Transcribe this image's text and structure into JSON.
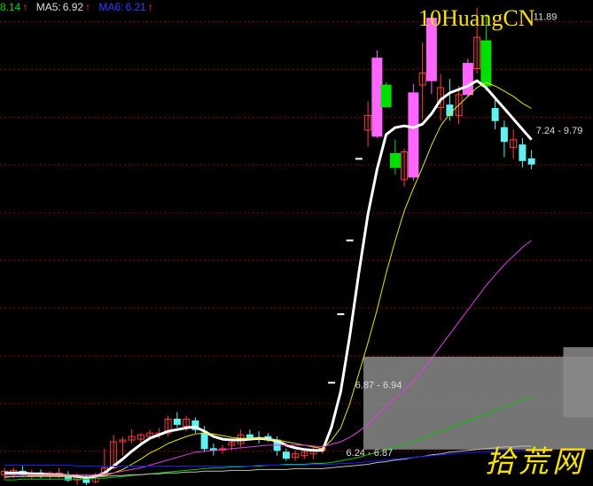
{
  "legend": {
    "ma_first_value": "8.14",
    "ma5_label": "MA5:",
    "ma5_value": "6.92",
    "ma6_label": "MA6:",
    "ma6_value": "6.21",
    "arrow": "↑"
  },
  "brand_text": "10HuangCN",
  "watermark_text": "拾荒网",
  "colors": {
    "background": "#000000",
    "grid": "#8b0000",
    "up_candle": "#ff3b3b",
    "down_candle": "#5ef2f2",
    "highlight_magenta": "#ff66ff",
    "highlight_green": "#00e000",
    "ma_white": "#ffffff",
    "ma_yellow": "#e6e600",
    "ma_magenta": "#e040e0",
    "ma_green": "#00c800",
    "ma_gray": "#bdbdbd",
    "ma_blue": "#1a1aff",
    "zone_fill": "#8a8a8a",
    "legend_green": "#00d000",
    "legend_white": "#dddddd",
    "legend_blue": "#3a3aff",
    "legend_arrow": "#ff3b3b",
    "brand_yellow": "#f5e200"
  },
  "chart_data": {
    "type": "candlestick",
    "price_labels": [
      "11.89",
      "7.24 - 9.79",
      "6.87 - 6.94",
      "6.24 - 6.87"
    ],
    "zones": [
      {
        "from": 6.87,
        "to": 7.94,
        "start_index": 40,
        "label": "6.87 - 6.94"
      },
      {
        "from": 7.24,
        "to": 8.05,
        "start_index": 62,
        "label": "7.24 - 9.79"
      }
    ],
    "candles": [
      {
        "o": 6.58,
        "h": 6.66,
        "l": 6.52,
        "c": 6.62,
        "s": "up"
      },
      {
        "o": 6.6,
        "h": 6.66,
        "l": 6.54,
        "c": 6.63,
        "s": "up"
      },
      {
        "o": 6.62,
        "h": 6.68,
        "l": 6.56,
        "c": 6.58,
        "s": "down"
      },
      {
        "o": 6.56,
        "h": 6.64,
        "l": 6.52,
        "c": 6.6,
        "s": "up"
      },
      {
        "o": 6.6,
        "h": 6.64,
        "l": 6.54,
        "c": 6.57,
        "s": "down"
      },
      {
        "o": 6.56,
        "h": 6.62,
        "l": 6.52,
        "c": 6.6,
        "s": "up"
      },
      {
        "o": 6.6,
        "h": 6.66,
        "l": 6.54,
        "c": 6.56,
        "s": "up"
      },
      {
        "o": 6.56,
        "h": 6.62,
        "l": 6.5,
        "c": 6.52,
        "s": "down"
      },
      {
        "o": 6.52,
        "h": 6.6,
        "l": 6.46,
        "c": 6.55,
        "s": "up"
      },
      {
        "o": 6.54,
        "h": 6.58,
        "l": 6.46,
        "c": 6.49,
        "s": "down"
      },
      {
        "o": 6.5,
        "h": 6.6,
        "l": 6.48,
        "c": 6.58,
        "s": "up"
      },
      {
        "o": 6.58,
        "h": 6.88,
        "l": 6.56,
        "c": 6.66,
        "s": "up"
      },
      {
        "o": 6.66,
        "h": 7.04,
        "l": 6.64,
        "c": 6.96,
        "s": "up"
      },
      {
        "o": 6.96,
        "h": 7.02,
        "l": 6.8,
        "c": 6.98,
        "s": "up"
      },
      {
        "o": 6.98,
        "h": 7.1,
        "l": 6.94,
        "c": 7.02,
        "s": "up"
      },
      {
        "o": 6.99,
        "h": 7.06,
        "l": 6.92,
        "c": 7.04,
        "s": "up"
      },
      {
        "o": 7.02,
        "h": 7.1,
        "l": 6.98,
        "c": 7.06,
        "s": "up"
      },
      {
        "o": 7.04,
        "h": 7.12,
        "l": 7.0,
        "c": 7.06,
        "s": "up"
      },
      {
        "o": 7.06,
        "h": 7.26,
        "l": 7.02,
        "c": 7.22,
        "s": "up"
      },
      {
        "o": 7.22,
        "h": 7.3,
        "l": 7.12,
        "c": 7.16,
        "s": "down"
      },
      {
        "o": 7.14,
        "h": 7.26,
        "l": 7.08,
        "c": 7.22,
        "s": "up"
      },
      {
        "o": 7.2,
        "h": 7.24,
        "l": 7.06,
        "c": 7.1,
        "s": "down"
      },
      {
        "o": 7.06,
        "h": 7.14,
        "l": 6.84,
        "c": 6.88,
        "s": "down"
      },
      {
        "o": 6.88,
        "h": 6.94,
        "l": 6.8,
        "c": 6.86,
        "s": "down"
      },
      {
        "o": 6.88,
        "h": 6.92,
        "l": 6.82,
        "c": 6.88,
        "s": "up"
      },
      {
        "o": 6.92,
        "h": 7.0,
        "l": 6.86,
        "c": 6.95,
        "s": "up"
      },
      {
        "o": 6.94,
        "h": 7.1,
        "l": 6.9,
        "c": 7.04,
        "s": "up"
      },
      {
        "o": 7.04,
        "h": 7.1,
        "l": 6.98,
        "c": 7.0,
        "s": "down"
      },
      {
        "o": 7.0,
        "h": 7.08,
        "l": 6.94,
        "c": 7.0,
        "s": "down"
      },
      {
        "o": 7.02,
        "h": 7.06,
        "l": 6.96,
        "c": 6.98,
        "s": "down"
      },
      {
        "o": 6.98,
        "h": 7.02,
        "l": 6.8,
        "c": 6.86,
        "s": "down"
      },
      {
        "o": 6.84,
        "h": 6.88,
        "l": 6.74,
        "c": 6.77,
        "s": "down"
      },
      {
        "o": 6.78,
        "h": 6.86,
        "l": 6.74,
        "c": 6.82,
        "s": "up"
      },
      {
        "o": 6.8,
        "h": 6.88,
        "l": 6.76,
        "c": 6.84,
        "s": "up"
      },
      {
        "o": 6.82,
        "h": 6.9,
        "l": 6.76,
        "c": 6.86,
        "s": "up"
      },
      {
        "o": 6.86,
        "h": 6.92,
        "l": 6.82,
        "c": 6.88,
        "s": "up"
      },
      {
        "o": 7.64,
        "h": 7.64,
        "l": 7.64,
        "c": 7.64,
        "s": "flat"
      },
      {
        "o": 8.43,
        "h": 8.43,
        "l": 8.43,
        "c": 8.43,
        "s": "flat"
      },
      {
        "o": 9.28,
        "h": 9.28,
        "l": 9.28,
        "c": 9.28,
        "s": "flat"
      },
      {
        "o": 10.22,
        "h": 10.22,
        "l": 10.22,
        "c": 10.22,
        "s": "flat"
      },
      {
        "o": 10.55,
        "h": 10.88,
        "l": 10.36,
        "c": 10.72,
        "s": "up"
      },
      {
        "o": 10.48,
        "h": 11.47,
        "l": 10.46,
        "c": 11.38,
        "s": "up_highlight"
      },
      {
        "o": 11.07,
        "h": 11.1,
        "l": 10.81,
        "c": 10.82,
        "s": "down_highlight"
      },
      {
        "o": 10.12,
        "h": 10.44,
        "l": 10.04,
        "c": 10.28,
        "s": "down_highlight"
      },
      {
        "o": 9.98,
        "h": 10.34,
        "l": 9.9,
        "c": 10.3,
        "s": "up"
      },
      {
        "o": 10.01,
        "h": 11.08,
        "l": 9.97,
        "c": 10.98,
        "s": "up_highlight"
      },
      {
        "o": 11.07,
        "h": 11.56,
        "l": 10.68,
        "c": 11.21,
        "s": "up"
      },
      {
        "o": 11.12,
        "h": 11.86,
        "l": 10.97,
        "c": 11.84,
        "s": "up_highlight"
      },
      {
        "o": 11.04,
        "h": 11.2,
        "l": 10.66,
        "c": 10.81,
        "s": "up"
      },
      {
        "o": 10.84,
        "h": 11.14,
        "l": 10.66,
        "c": 10.72,
        "s": "down"
      },
      {
        "o": 10.72,
        "h": 11.06,
        "l": 10.62,
        "c": 10.96,
        "s": "up"
      },
      {
        "o": 10.96,
        "h": 11.37,
        "l": 10.93,
        "c": 11.32,
        "s": "up_highlight"
      },
      {
        "o": 11.26,
        "h": 11.96,
        "l": 11.2,
        "c": 11.62,
        "s": "up"
      },
      {
        "o": 11.58,
        "h": 11.89,
        "l": 11.0,
        "c": 11.06,
        "s": "down_highlight"
      },
      {
        "o": 10.8,
        "h": 10.94,
        "l": 10.56,
        "c": 10.66,
        "s": "down"
      },
      {
        "o": 10.58,
        "h": 10.66,
        "l": 10.24,
        "c": 10.42,
        "s": "down"
      },
      {
        "o": 10.44,
        "h": 10.56,
        "l": 10.22,
        "c": 10.35,
        "s": "up"
      },
      {
        "o": 10.38,
        "h": 10.46,
        "l": 10.12,
        "c": 10.2,
        "s": "down"
      },
      {
        "o": 10.22,
        "h": 10.32,
        "l": 10.1,
        "c": 10.16,
        "s": "down"
      }
    ],
    "moving_averages": [
      {
        "color": "ma_white",
        "width": 3,
        "values": [
          6.6,
          6.6,
          6.6,
          6.59,
          6.59,
          6.58,
          6.58,
          6.57,
          6.56,
          6.55,
          6.56,
          6.6,
          6.68,
          6.76,
          6.85,
          6.93,
          7.0,
          7.04,
          7.08,
          7.1,
          7.12,
          7.13,
          7.08,
          7.02,
          6.99,
          6.98,
          6.98,
          6.99,
          7.0,
          6.99,
          6.97,
          6.92,
          6.89,
          6.87,
          6.86,
          6.86,
          7.13,
          7.54,
          8.18,
          8.91,
          9.58,
          10.1,
          10.5,
          10.58,
          10.6,
          10.58,
          10.62,
          10.74,
          10.9,
          10.98,
          11.02,
          11.06,
          11.12,
          11.04,
          10.92,
          10.8,
          10.68,
          10.56,
          10.44
        ]
      },
      {
        "color": "ma_yellow",
        "width": 1,
        "values": [
          6.55,
          6.56,
          6.56,
          6.57,
          6.57,
          6.57,
          6.57,
          6.57,
          6.56,
          6.56,
          6.56,
          6.57,
          6.6,
          6.64,
          6.7,
          6.76,
          6.83,
          6.88,
          6.94,
          6.98,
          7.02,
          7.05,
          7.06,
          7.05,
          7.03,
          7.01,
          7.0,
          7.0,
          7.0,
          6.99,
          6.98,
          6.96,
          6.94,
          6.92,
          6.9,
          6.88,
          6.98,
          7.12,
          7.4,
          7.75,
          8.1,
          8.48,
          8.9,
          9.28,
          9.62,
          9.88,
          10.12,
          10.38,
          10.6,
          10.74,
          10.84,
          10.94,
          11.04,
          11.1,
          11.06,
          11.0,
          10.94,
          10.86,
          10.8
        ]
      },
      {
        "color": "ma_magenta",
        "width": 1,
        "values": [
          6.58,
          6.58,
          6.58,
          6.58,
          6.58,
          6.58,
          6.58,
          6.58,
          6.58,
          6.58,
          6.58,
          6.59,
          6.6,
          6.62,
          6.64,
          6.66,
          6.69,
          6.72,
          6.75,
          6.78,
          6.81,
          6.84,
          6.85,
          6.86,
          6.87,
          6.88,
          6.89,
          6.9,
          6.91,
          6.92,
          6.92,
          6.92,
          6.92,
          6.92,
          6.91,
          6.9,
          6.93,
          6.96,
          7.01,
          7.08,
          7.16,
          7.26,
          7.36,
          7.46,
          7.56,
          7.66,
          7.78,
          7.92,
          8.06,
          8.2,
          8.34,
          8.48,
          8.62,
          8.76,
          8.88,
          9.0,
          9.1,
          9.2,
          9.28
        ]
      },
      {
        "color": "ma_green",
        "width": 1,
        "values": [
          6.52,
          6.52,
          6.53,
          6.53,
          6.53,
          6.53,
          6.53,
          6.53,
          6.53,
          6.53,
          6.54,
          6.54,
          6.55,
          6.56,
          6.57,
          6.58,
          6.59,
          6.6,
          6.61,
          6.62,
          6.63,
          6.64,
          6.65,
          6.66,
          6.66,
          6.67,
          6.67,
          6.68,
          6.68,
          6.69,
          6.69,
          6.7,
          6.7,
          6.7,
          6.71,
          6.71,
          6.72,
          6.74,
          6.76,
          6.78,
          6.81,
          6.84,
          6.87,
          6.9,
          6.93,
          6.96,
          7.0,
          7.04,
          7.08,
          7.12,
          7.16,
          7.2,
          7.24,
          7.28,
          7.32,
          7.36,
          7.4,
          7.44,
          7.48
        ]
      },
      {
        "color": "ma_gray",
        "width": 1,
        "values": [
          6.56,
          6.56,
          6.56,
          6.56,
          6.56,
          6.56,
          6.56,
          6.56,
          6.56,
          6.56,
          6.56,
          6.56,
          6.57,
          6.57,
          6.58,
          6.58,
          6.59,
          6.59,
          6.6,
          6.6,
          6.61,
          6.61,
          6.62,
          6.62,
          6.62,
          6.63,
          6.63,
          6.63,
          6.64,
          6.64,
          6.64,
          6.64,
          6.65,
          6.65,
          6.65,
          6.65,
          6.66,
          6.67,
          6.68,
          6.69,
          6.7,
          6.72,
          6.73,
          6.75,
          6.76,
          6.78,
          6.79,
          6.81,
          6.82,
          6.84,
          6.85,
          6.86,
          6.87,
          6.88,
          6.89,
          6.9,
          6.9,
          6.91,
          6.91
        ]
      },
      {
        "color": "ma_blue",
        "width": 1,
        "values": [
          6.69,
          6.69,
          6.69,
          6.69,
          6.69,
          6.69,
          6.69,
          6.69,
          6.68,
          6.68,
          6.68,
          6.68,
          6.68,
          6.68,
          6.68,
          6.68,
          6.68,
          6.68,
          6.68,
          6.68,
          6.68,
          6.68,
          6.68,
          6.68,
          6.68,
          6.68,
          6.68,
          6.68,
          6.69,
          6.69,
          6.69,
          6.69,
          6.69,
          6.69,
          6.7,
          6.7,
          6.7,
          6.71,
          6.71,
          6.72,
          6.73,
          6.74,
          6.75,
          6.76,
          6.77,
          6.78,
          6.79,
          6.8,
          6.81,
          6.82,
          6.83,
          6.83,
          6.84,
          6.84,
          6.85,
          6.85,
          6.85,
          6.86,
          6.86
        ]
      }
    ],
    "y_range": [
      6.45,
      12.05
    ],
    "grid_levels": [
      11.8,
      11.25,
      10.7,
      10.15,
      9.6,
      9.05,
      8.5,
      7.95,
      7.4,
      6.85
    ]
  }
}
